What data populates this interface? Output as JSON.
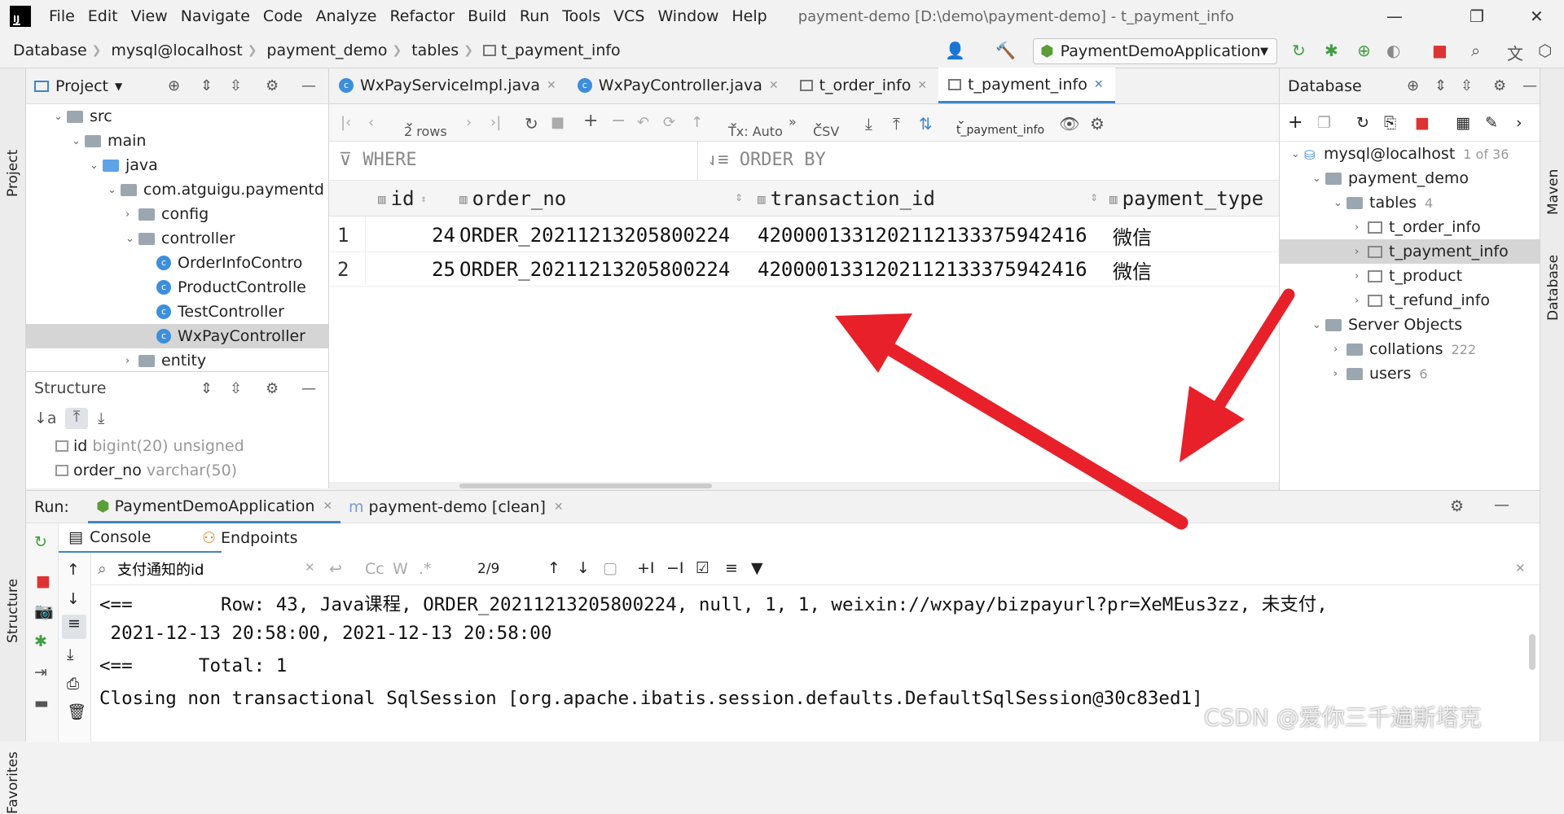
{
  "menubar": {
    "items": [
      "File",
      "Edit",
      "View",
      "Navigate",
      "Code",
      "Analyze",
      "Refactor",
      "Build",
      "Run",
      "Tools",
      "VCS",
      "Window",
      "Help"
    ],
    "title": "payment-demo [D:\\demo\\payment-demo] - t_payment_info"
  },
  "navbar": {
    "breadcrumb": [
      "Database",
      "mysql@localhost",
      "payment_demo",
      "tables",
      "t_payment_info"
    ],
    "run_config": "PaymentDemoApplication"
  },
  "project_panel": {
    "title": "Project",
    "tree": [
      {
        "label": "src",
        "depth": 0,
        "kind": "folder"
      },
      {
        "label": "main",
        "depth": 1,
        "kind": "folder"
      },
      {
        "label": "java",
        "depth": 2,
        "kind": "folder-blue"
      },
      {
        "label": "com.atguigu.paymentd",
        "depth": 3,
        "kind": "package"
      },
      {
        "label": "config",
        "depth": 4,
        "kind": "package"
      },
      {
        "label": "controller",
        "depth": 4,
        "kind": "package"
      },
      {
        "label": "OrderInfoContro",
        "depth": 5,
        "kind": "class"
      },
      {
        "label": "ProductControlle",
        "depth": 5,
        "kind": "class"
      },
      {
        "label": "TestController",
        "depth": 5,
        "kind": "class"
      },
      {
        "label": "WxPayController",
        "depth": 5,
        "kind": "class"
      },
      {
        "label": "entity",
        "depth": 4,
        "kind": "package"
      }
    ]
  },
  "structure_panel": {
    "title": "Structure",
    "fields": [
      {
        "name": "id",
        "type": "bigint(20) unsigned"
      },
      {
        "name": "order_no",
        "type": "varchar(50)"
      }
    ]
  },
  "editor_tabs": [
    "WxPayServiceImpl.java",
    "WxPayController.java",
    "t_order_info",
    "t_payment_info"
  ],
  "grid_toolbar": {
    "rows": "2 rows",
    "tx": "Tx: Auto",
    "format": "CSV",
    "table": "t_payment_info"
  },
  "filter": {
    "where": "WHERE",
    "order_by": "ORDER BY"
  },
  "grid": {
    "columns": [
      "id",
      "order_no",
      "transaction_id",
      "payment_type"
    ],
    "rows": [
      {
        "num": "1",
        "id": "24",
        "order_no": "ORDER_20211213205800224",
        "transaction_id": "4200001331202112133375942416",
        "payment_type": "微信"
      },
      {
        "num": "2",
        "id": "25",
        "order_no": "ORDER_20211213205800224",
        "transaction_id": "4200001331202112133375942416",
        "payment_type": "微信"
      }
    ]
  },
  "database_panel": {
    "title": "Database",
    "tree": [
      {
        "label": "mysql@localhost",
        "count": "1 of 36",
        "depth": 0
      },
      {
        "label": "payment_demo",
        "count": "",
        "depth": 1
      },
      {
        "label": "tables",
        "count": "4",
        "depth": 2
      },
      {
        "label": "t_order_info",
        "count": "",
        "depth": 3
      },
      {
        "label": "t_payment_info",
        "count": "",
        "depth": 3
      },
      {
        "label": "t_product",
        "count": "",
        "depth": 3
      },
      {
        "label": "t_refund_info",
        "count": "",
        "depth": 3
      },
      {
        "label": "Server Objects",
        "count": "",
        "depth": 1
      },
      {
        "label": "collations",
        "count": "222",
        "depth": 2
      },
      {
        "label": "users",
        "count": "6",
        "depth": 2
      }
    ]
  },
  "run_panel": {
    "label": "Run:",
    "tabs": [
      "PaymentDemoApplication",
      "payment-demo [clean]"
    ],
    "subtabs": [
      "Console",
      "Endpoints"
    ],
    "search_text": "支付通知的id",
    "search_count": "2/9",
    "lines": [
      "<==        Row: 43, Java课程, ORDER_20211213205800224, null, 1, 1, weixin://wxpay/bizpayurl?pr=XeMEus3zz, 未支付,",
      " 2021-12-13 20:58:00, 2021-12-13 20:58:00",
      "<==      Total: 1",
      "Closing non transactional SqlSession [org.apache.ibatis.session.defaults.DefaultSqlSession@30c83ed1]"
    ]
  },
  "side_labels": {
    "left_project": "Project",
    "left_structure": "Structure",
    "left_favorites": "Favorites",
    "right_maven": "Maven",
    "right_database": "Database"
  },
  "watermark": "CSDN @爱你三千遍斯塔克",
  "accent_color": "#4083c9",
  "arrow_color": "#e8202a"
}
